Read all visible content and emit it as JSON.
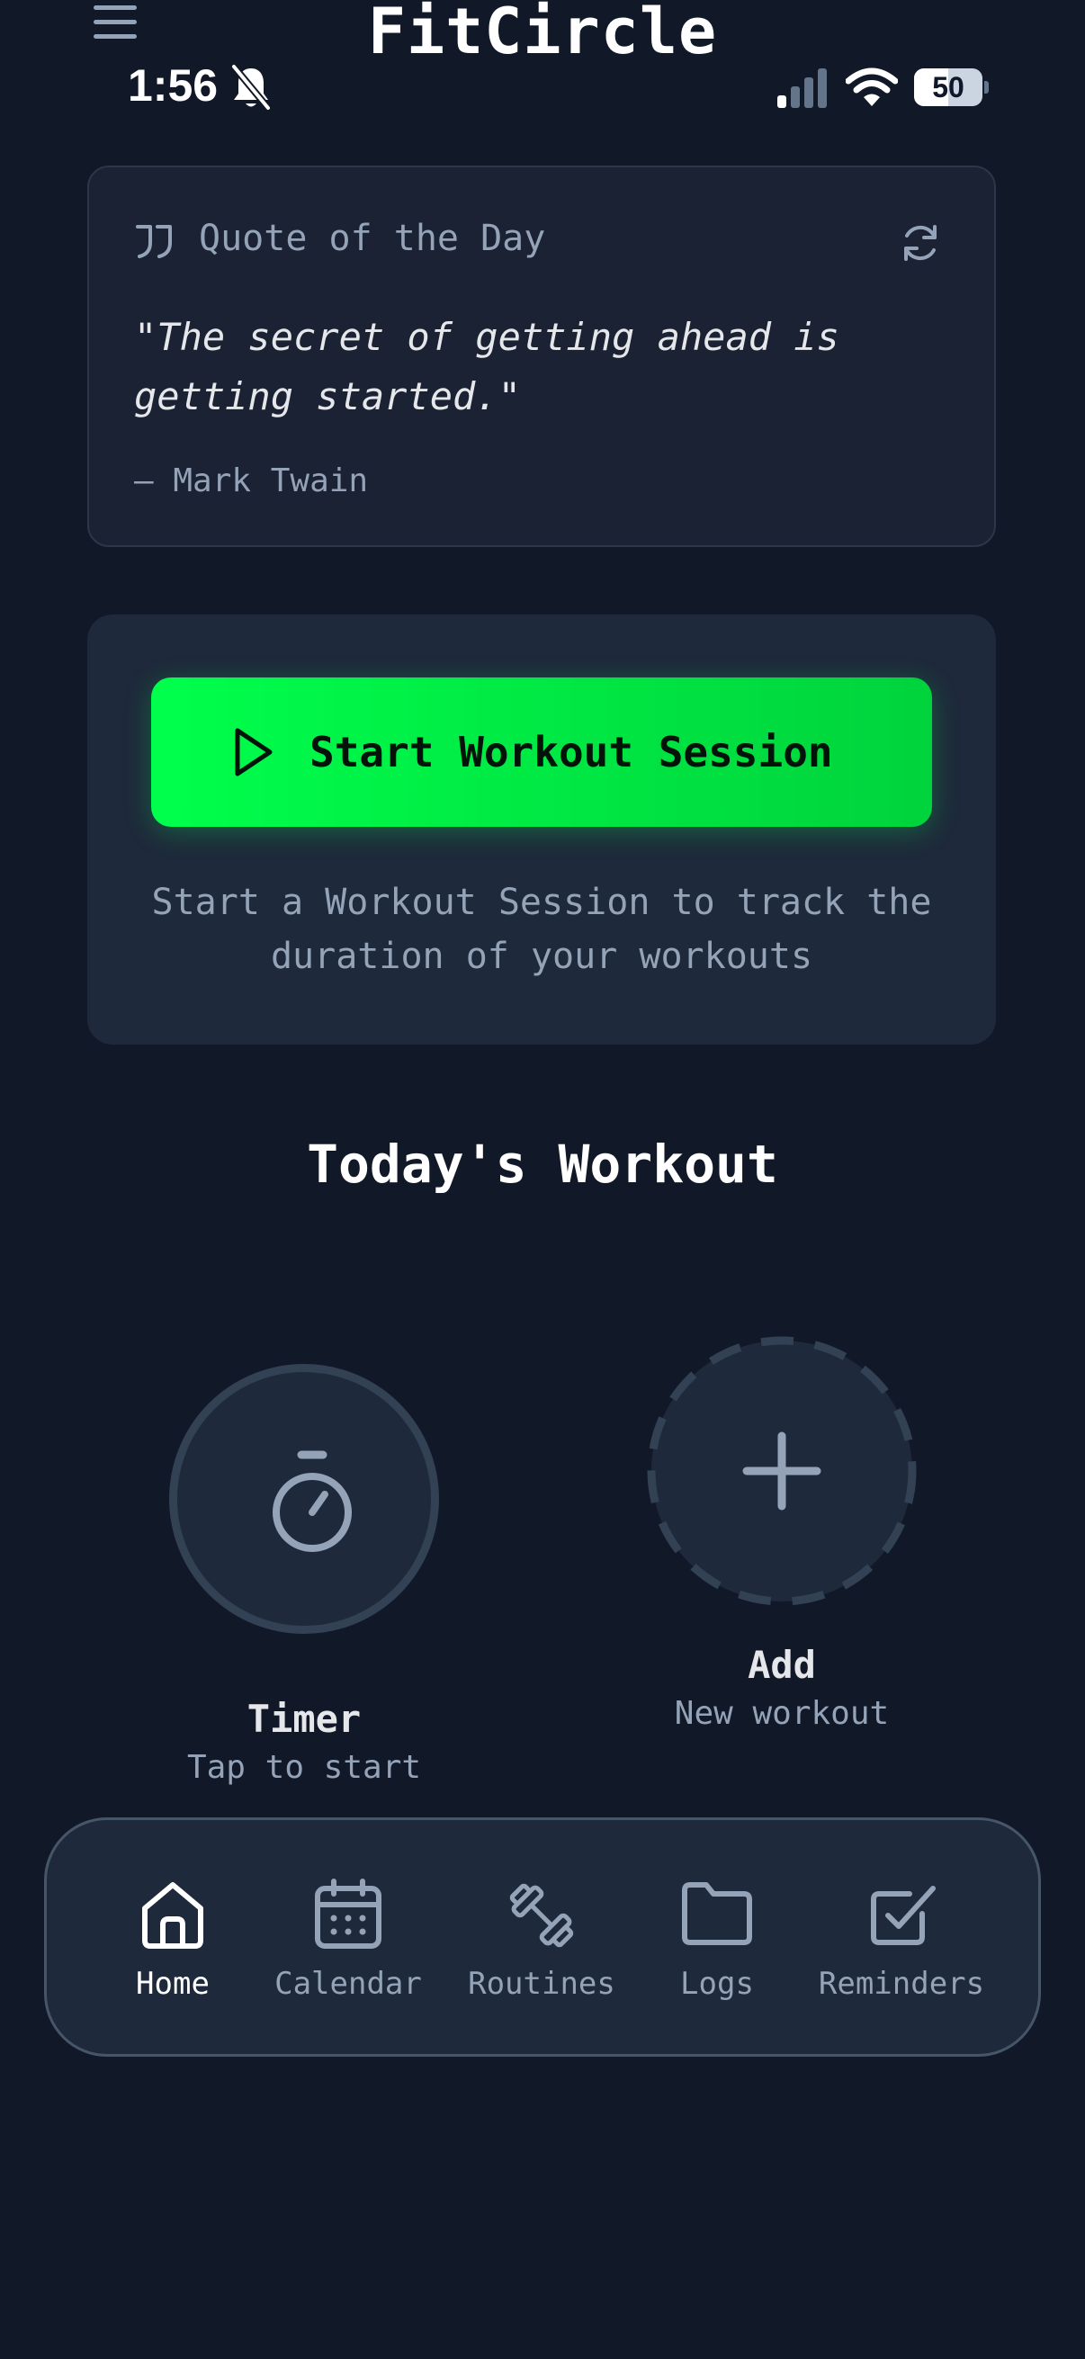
{
  "header": {
    "app_title": "FitCircle"
  },
  "status_bar": {
    "time": "1:56",
    "battery": "50",
    "battery_level": 0.5
  },
  "quote_card": {
    "heading": "Quote of the Day",
    "text": "\"The secret of getting ahead is getting started.\"",
    "author": "— Mark Twain"
  },
  "session_card": {
    "button_label": "Start Workout Session",
    "description": "Start a Workout Session to track the duration of your workouts",
    "accent_color": "#00ff4c"
  },
  "todays_workout": {
    "title": "Today's Workout",
    "timer": {
      "title": "Timer",
      "subtitle": "Tap to start"
    },
    "add": {
      "title": "Add",
      "subtitle": "New workout"
    }
  },
  "bottom_nav": {
    "items": [
      {
        "label": "Home",
        "icon": "home-icon",
        "active": true
      },
      {
        "label": "Calendar",
        "icon": "calendar-icon",
        "active": false
      },
      {
        "label": "Routines",
        "icon": "dumbbell-icon",
        "active": false
      },
      {
        "label": "Logs",
        "icon": "folder-icon",
        "active": false
      },
      {
        "label": "Reminders",
        "icon": "checkbox-icon",
        "active": false
      }
    ]
  }
}
